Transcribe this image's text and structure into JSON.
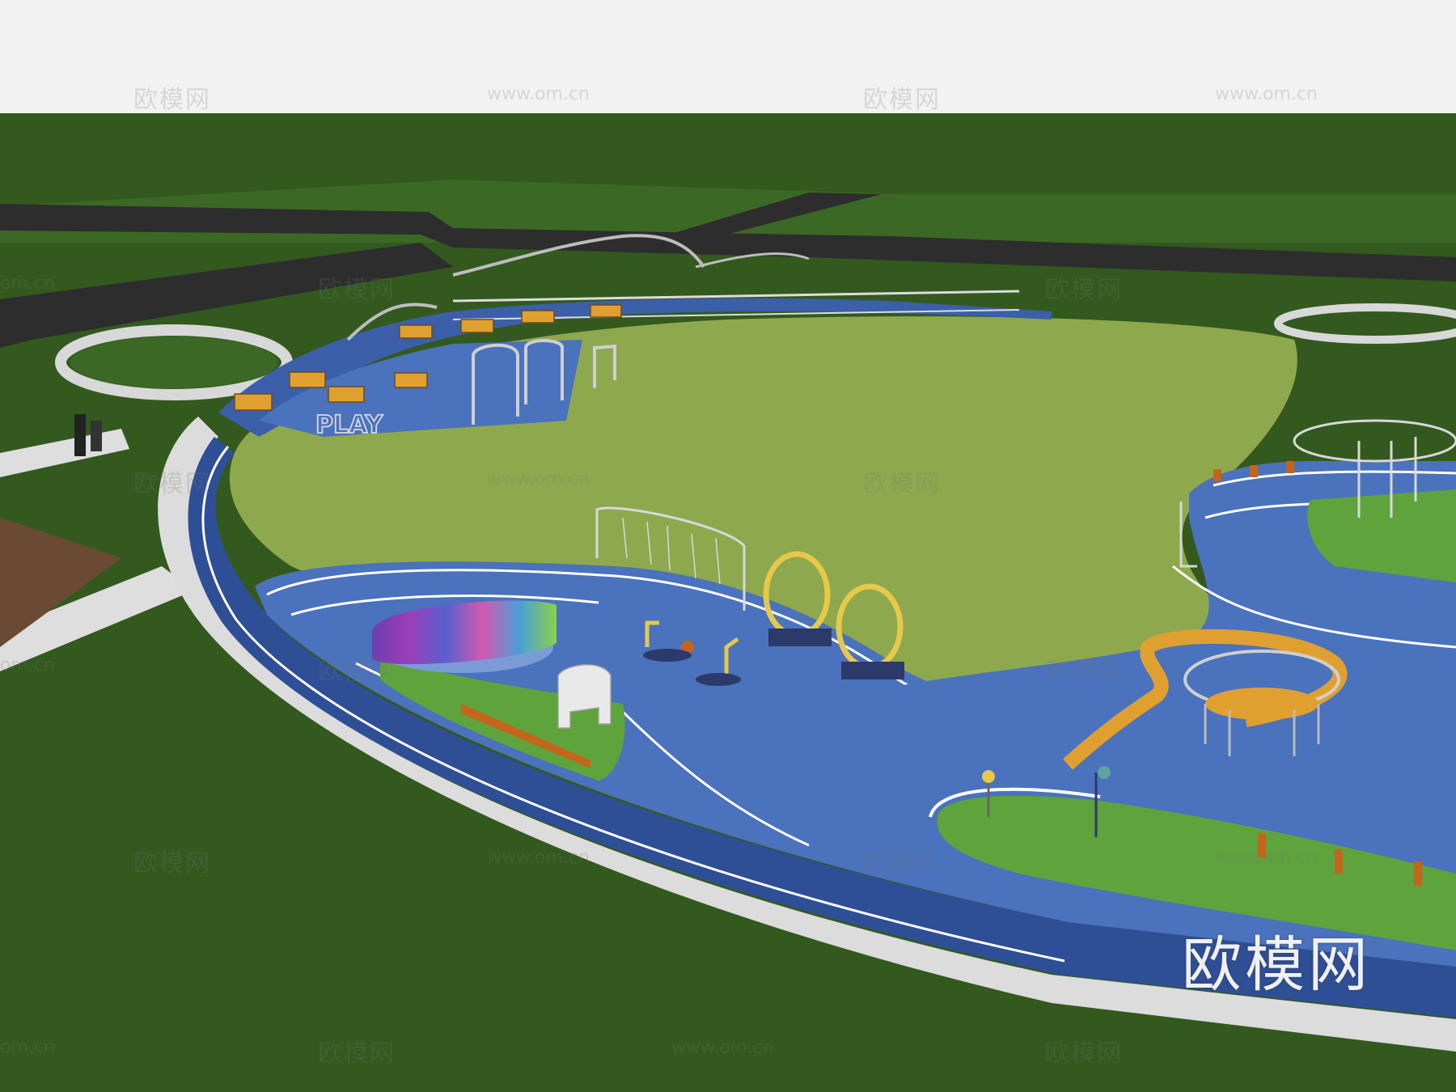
{
  "image": {
    "scene_type": "3d-rendering-park-playground-aerial",
    "colors": {
      "sky": "#f2f2f2",
      "grass_dark": "#33591e",
      "grass_light": "#8ea84d",
      "road": "#2d2d2d",
      "track_dark": "#2e4f96",
      "track_light": "#5b84c9",
      "path_white": "#dcdcdc",
      "accent_orange": "#e0a030",
      "accent_yellow": "#e6c84a"
    },
    "scene_texts": {
      "play_sign": "PLAY"
    }
  },
  "watermarks": {
    "brand": "欧模网",
    "url": "www.om.cn",
    "partial_url": "om.cn"
  }
}
